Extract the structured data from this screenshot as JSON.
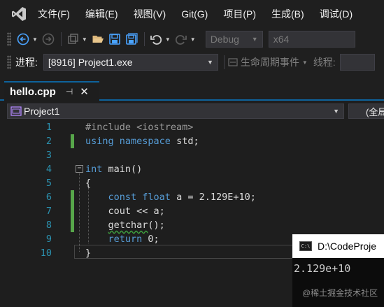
{
  "menu": {
    "items": [
      "文件(F)",
      "编辑(E)",
      "视图(V)",
      "Git(G)",
      "项目(P)",
      "生成(B)",
      "调试(D)"
    ]
  },
  "toolbar": {
    "icons": [
      "back-arrow-icon",
      "forward-arrow-icon",
      "new-project-icon",
      "open-folder-icon",
      "save-icon",
      "save-all-icon",
      "undo-icon",
      "redo-icon"
    ],
    "configuration": "Debug",
    "platform": "x64"
  },
  "debug_bar": {
    "process_label": "进程:",
    "process_value": "[8916] Project1.exe",
    "lifecycle_label": "生命周期事件",
    "thread_label": "线程:"
  },
  "tab": {
    "title": "hello.cpp",
    "pin_glyph": "⊣",
    "close_glyph": "✕"
  },
  "navbar": {
    "project": "Project1",
    "scope": "(全局"
  },
  "editor": {
    "line_numbers": [
      "1",
      "2",
      "3",
      "4",
      "5",
      "6",
      "7",
      "8",
      "9",
      "10"
    ],
    "lines": [
      {
        "indent": "",
        "tokens": [
          {
            "t": "#include <iostream>",
            "c": "pp"
          }
        ]
      },
      {
        "indent": "",
        "tokens": [
          {
            "t": "using",
            "c": "kw"
          },
          {
            "t": " "
          },
          {
            "t": "namespace",
            "c": "kw"
          },
          {
            "t": " std;"
          }
        ]
      },
      {
        "indent": "",
        "tokens": []
      },
      {
        "indent": "",
        "tokens": [
          {
            "t": "int",
            "c": "kw"
          },
          {
            "t": " main()"
          }
        ]
      },
      {
        "indent": "",
        "tokens": [
          {
            "t": "{"
          }
        ]
      },
      {
        "indent": "    ",
        "tokens": [
          {
            "t": "const",
            "c": "kw"
          },
          {
            "t": " "
          },
          {
            "t": "float",
            "c": "kw"
          },
          {
            "t": " a = 2.129E+10;"
          }
        ]
      },
      {
        "indent": "    ",
        "tokens": [
          {
            "t": "cout << a;"
          }
        ]
      },
      {
        "indent": "    ",
        "tokens": [
          {
            "t": "getchar",
            "c": "squiggle"
          },
          {
            "t": "();"
          }
        ]
      },
      {
        "indent": "    ",
        "tokens": [
          {
            "t": "return",
            "c": "kw"
          },
          {
            "t": " 0;"
          }
        ]
      },
      {
        "indent": "",
        "tokens": [
          {
            "t": "}"
          }
        ]
      }
    ],
    "changed_lines": [
      2,
      6,
      7,
      8
    ],
    "fold_glyph": "−"
  },
  "console": {
    "icon_text": "C:\\",
    "title": "D:\\CodeProje",
    "output": "2.129e+10"
  },
  "watermark": "@稀土掘金技术社区"
}
